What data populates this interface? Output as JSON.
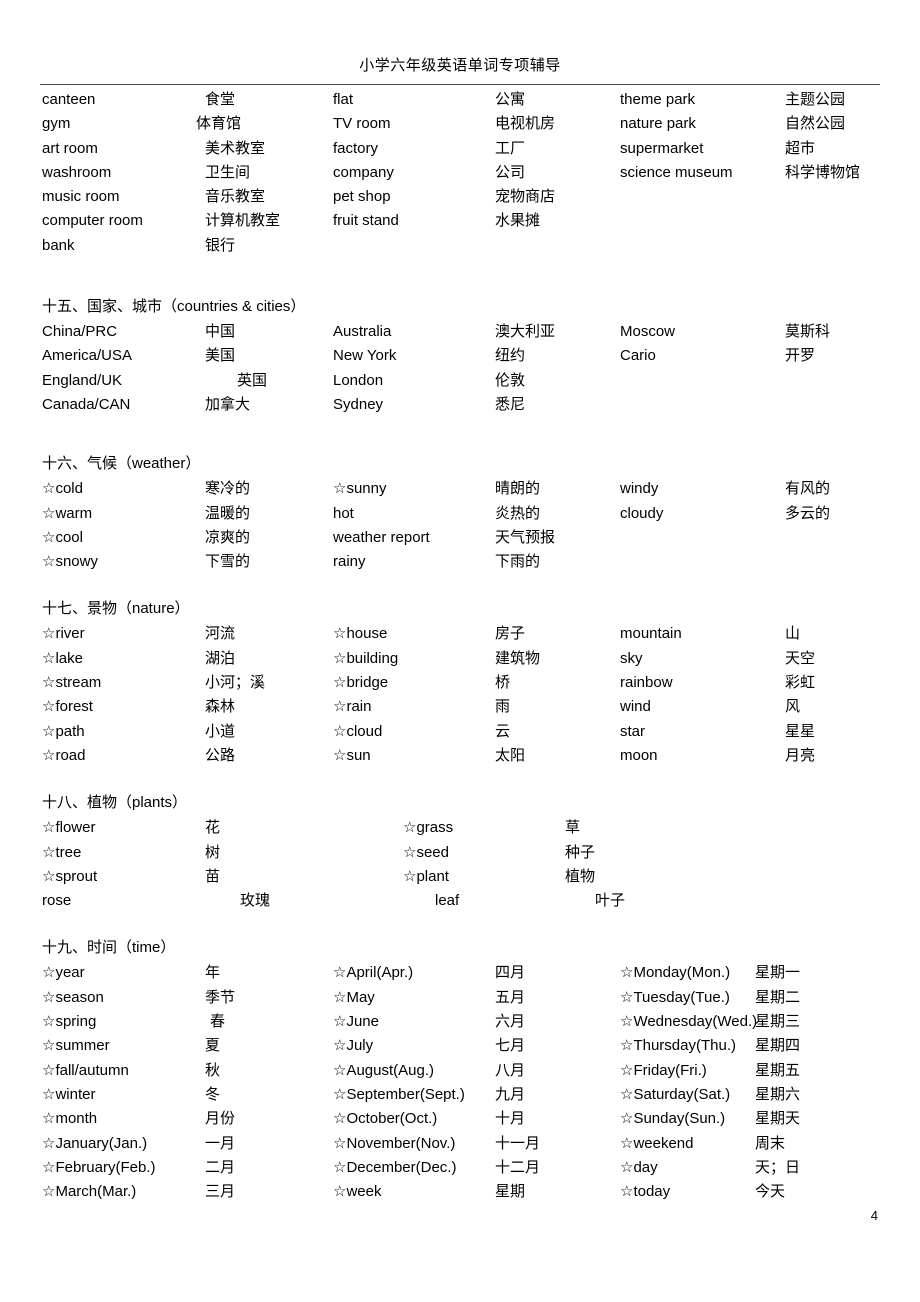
{
  "header": {
    "title": "小学六年级英语单词专项辅导"
  },
  "page_number": "4",
  "sections": [
    {
      "id": "places-continued",
      "heading": "",
      "rows": [
        {
          "c1e": "canteen",
          "c1c": "食堂",
          "c2e": "flat",
          "c2c": "公寓",
          "c3e": "theme park",
          "c3c": "主题公园"
        },
        {
          "c1e": "gym",
          "c1c": "体育馆",
          "c2e": "TV room",
          "c2c": "电视机房",
          "c3e": "nature park",
          "c3c": "自然公园"
        },
        {
          "c1e": "art    room",
          "c1c": "美术教室",
          "c2e": "factory",
          "c2c": "工厂",
          "c3e": "supermarket",
          "c3c": "超市"
        },
        {
          "c1e": "washroom",
          "c1c": "卫生间",
          "c2e": "company",
          "c2c": "公司",
          "c3e": "science museum",
          "c3c": "科学博物馆"
        },
        {
          "c1e": "music room",
          "c1c": "音乐教室",
          "c2e": "pet shop",
          "c2c": "宠物商店",
          "c3e": "",
          "c3c": ""
        },
        {
          "c1e": "computer room",
          "c1c": "计算机教室",
          "c2e": "fruit stand",
          "c2c": "水果摊",
          "c3e": "",
          "c3c": ""
        },
        {
          "c1e": "bank",
          "c1c": "银行",
          "c2e": "",
          "c2c": "",
          "c3e": "",
          "c3c": ""
        }
      ]
    },
    {
      "id": "countries-cities",
      "heading": "十五、国家、城市（countries & cities）",
      "rows": [
        {
          "c1e": "China/PRC",
          "c1c": "中国",
          "c2e": "Australia",
          "c2c": "澳大利亚",
          "c3e": "Moscow",
          "c3c": "莫斯科"
        },
        {
          "c1e": "America/USA",
          "c1c": "美国",
          "c2e": "New York",
          "c2c": "纽约",
          "c3e": "Cario",
          "c3c": "开罗"
        },
        {
          "c1e": "England/UK",
          "c1c": "英国",
          "c2e": "London",
          "c2c": "伦敦",
          "c3e": "",
          "c3c": ""
        },
        {
          "c1e": "Canada/CAN",
          "c1c": "加拿大",
          "c2e": "Sydney",
          "c2c": "悉尼",
          "c3e": "",
          "c3c": ""
        }
      ]
    },
    {
      "id": "weather",
      "heading": "十六、气候（weather）",
      "rows": [
        {
          "c1e": "☆cold",
          "c1c": "寒冷的",
          "c2e": "☆sunny",
          "c2c": "晴朗的",
          "c3e": "windy",
          "c3c": "有风的"
        },
        {
          "c1e": "☆warm",
          "c1c": "温暖的",
          "c2e": "hot",
          "c2c": "炎热的",
          "c3e": "cloudy",
          "c3c": "多云的"
        },
        {
          "c1e": "☆cool",
          "c1c": "凉爽的",
          "c2e": "weather report",
          "c2c": "天气预报",
          "c3e": "",
          "c3c": ""
        },
        {
          "c1e": "☆snowy",
          "c1c": "下雪的",
          "c2e": "rainy",
          "c2c": "下雨的",
          "c3e": "",
          "c3c": ""
        }
      ]
    },
    {
      "id": "nature",
      "heading": "十七、景物（nature）",
      "rows": [
        {
          "c1e": "☆river",
          "c1c": "河流",
          "c2e": "☆house",
          "c2c": "房子",
          "c3e": "mountain",
          "c3c": "山"
        },
        {
          "c1e": "☆lake",
          "c1c": "湖泊",
          "c2e": "☆building",
          "c2c": "建筑物",
          "c3e": "sky",
          "c3c": "天空"
        },
        {
          "c1e": "☆stream",
          "c1c": "小河；溪",
          "c2e": "☆bridge",
          "c2c": "桥",
          "c3e": "rainbow",
          "c3c": "彩虹"
        },
        {
          "c1e": "☆forest",
          "c1c": "森林",
          "c2e": "☆rain",
          "c2c": "雨",
          "c3e": "wind",
          "c3c": "风"
        },
        {
          "c1e": "☆path",
          "c1c": "小道",
          "c2e": "☆cloud",
          "c2c": "云",
          "c3e": "star",
          "c3c": "星星"
        },
        {
          "c1e": "☆road",
          "c1c": "公路",
          "c2e": "☆sun",
          "c2c": "太阳",
          "c3e": "moon",
          "c3c": "月亮"
        }
      ]
    },
    {
      "id": "plants",
      "heading": "十八、植物（plants）",
      "rows": [
        {
          "c1e": "☆flower",
          "c1c": "花",
          "c2e": "☆grass",
          "c2c": "草"
        },
        {
          "c1e": "☆tree",
          "c1c": "树",
          "c2e": "☆seed",
          "c2c": "种子"
        },
        {
          "c1e": "☆sprout",
          "c1c": "苗",
          "c2e": "☆plant",
          "c2c": "植物"
        },
        {
          "c1e": "rose",
          "c1c": "玫瑰",
          "c2e": "leaf",
          "c2c": "叶子"
        }
      ]
    },
    {
      "id": "time",
      "heading": "十九、时间（time）",
      "rows": [
        {
          "c1e": "☆year",
          "c1c": "年",
          "c2e": "☆April(Apr.)",
          "c2c": "四月",
          "c3e": "☆Monday(Mon.)",
          "c3c": "星期一"
        },
        {
          "c1e": "☆season",
          "c1c": "季节",
          "c2e": "☆May",
          "c2c": "五月",
          "c3e": "☆Tuesday(Tue.)",
          "c3c": "星期二"
        },
        {
          "c1e": "☆spring",
          "c1c": "春",
          "c2e": "☆June",
          "c2c": "六月",
          "c3e": "☆Wednesday(Wed.)",
          "c3c": "星期三"
        },
        {
          "c1e": "☆summer",
          "c1c": "夏",
          "c2e": "☆July",
          "c2c": "七月",
          "c3e": "☆Thursday(Thu.)",
          "c3c": "星期四"
        },
        {
          "c1e": "☆fall/autumn",
          "c1c": "秋",
          "c2e": "☆August(Aug.)",
          "c2c": "八月",
          "c3e": "☆Friday(Fri.)",
          "c3c": "星期五"
        },
        {
          "c1e": "☆winter",
          "c1c": "冬",
          "c2e": "☆September(Sept.)",
          "c2c": "九月",
          "c3e": "☆Saturday(Sat.)",
          "c3c": "星期六"
        },
        {
          "c1e": "☆month",
          "c1c": "月份",
          "c2e": "☆October(Oct.)",
          "c2c": "十月",
          "c3e": "☆Sunday(Sun.)",
          "c3c": "星期天"
        },
        {
          "c1e": "☆January(Jan.)",
          "c1c": "一月",
          "c2e": "☆November(Nov.)",
          "c2c": "十一月",
          "c3e": "☆weekend",
          "c3c": "周末"
        },
        {
          "c1e": "☆February(Feb.)",
          "c1c": "二月",
          "c2e": "☆December(Dec.)",
          "c2c": "十二月",
          "c3e": "☆day",
          "c3c": "天；日"
        },
        {
          "c1e": "☆March(Mar.)",
          "c1c": "三月",
          "c2e": "☆week",
          "c2c": "星期",
          "c3e": "☆today",
          "c3c": "今天"
        }
      ]
    }
  ]
}
